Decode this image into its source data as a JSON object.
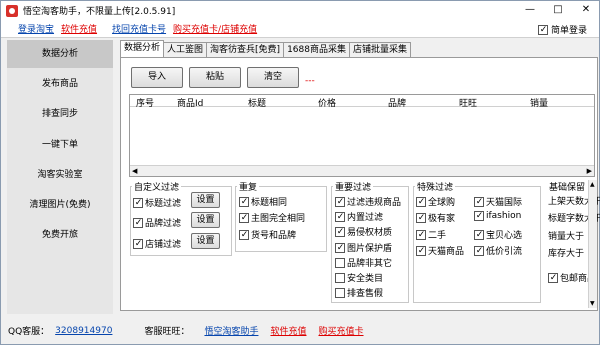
{
  "window": {
    "title": "悟空淘客助手，不限量上传[2.0.5.91]",
    "min": "—",
    "max": "□",
    "close": "✕"
  },
  "menu": {
    "items": [
      "登录淘宝",
      "软件充值",
      "找回充值卡号",
      "购买充值卡/店铺充值"
    ],
    "simple_login": "简单登录",
    "simple_login_checked": true
  },
  "sidebar": {
    "items": [
      "数据分析",
      "发布商品",
      "排查同步",
      "一键下单",
      "淘客实验室",
      "清理图片(免费)",
      "免费开旅"
    ]
  },
  "tabs": [
    "数据分析",
    "人工鉴图",
    "淘客彷查兵[免费]",
    "1688商品采集",
    "店铺批量采集"
  ],
  "toolbar": {
    "import": "导入",
    "paste": "粘贴",
    "clear": "清空",
    "marker": "---"
  },
  "grid": {
    "columns": [
      "序号",
      "商品Id",
      "标题",
      "价格",
      "品牌",
      "旺旺",
      "销量"
    ]
  },
  "filters": {
    "custom": {
      "title": "自定义过滤",
      "items": [
        {
          "label": "标题过滤",
          "checked": true,
          "button": "设置"
        },
        {
          "label": "品牌过滤",
          "checked": true,
          "button": "设置"
        },
        {
          "label": "店铺过滤",
          "checked": true,
          "button": "设置"
        }
      ]
    },
    "dup": {
      "title": "重复",
      "items": [
        {
          "label": "标题相同",
          "checked": true
        },
        {
          "label": "主图完全相同",
          "checked": true
        },
        {
          "label": "货号和品牌",
          "checked": true
        }
      ]
    },
    "important": {
      "title": "重要过滤",
      "items": [
        {
          "label": "过滤违规商品",
          "checked": true
        },
        {
          "label": "内置过滤",
          "checked": true
        },
        {
          "label": "易侵权材质",
          "checked": true
        },
        {
          "label": "图片保护盾",
          "checked": true
        },
        {
          "label": "品牌非其它",
          "checked": false
        },
        {
          "label": "安全类目",
          "checked": false
        },
        {
          "label": "排查售假",
          "checked": false
        }
      ]
    },
    "special": {
      "title": "特殊过滤",
      "items": [
        {
          "label": "全球购",
          "checked": true
        },
        {
          "label": "天猫国际",
          "checked": true
        },
        {
          "label": "极有家",
          "checked": true
        },
        {
          "label": "ifashion",
          "checked": true
        },
        {
          "label": "二手",
          "checked": true
        },
        {
          "label": "宝贝心选",
          "checked": true
        },
        {
          "label": "天猫商品",
          "checked": true
        },
        {
          "label": "低价引流",
          "checked": true
        }
      ]
    },
    "basic": {
      "title": "基础保留",
      "lines": [
        "上架天数大于",
        "标题字数大于",
        "销量大于",
        "库存大于"
      ],
      "item": {
        "label": "包邮商品",
        "checked": true
      }
    }
  },
  "status": {
    "qq_label": "QQ客服：",
    "qq": "3208914970",
    "ww_label": "客服旺旺：",
    "shop": "悟空淘客助手",
    "recharge": "软件充值",
    "buy": "购买充值卡"
  }
}
